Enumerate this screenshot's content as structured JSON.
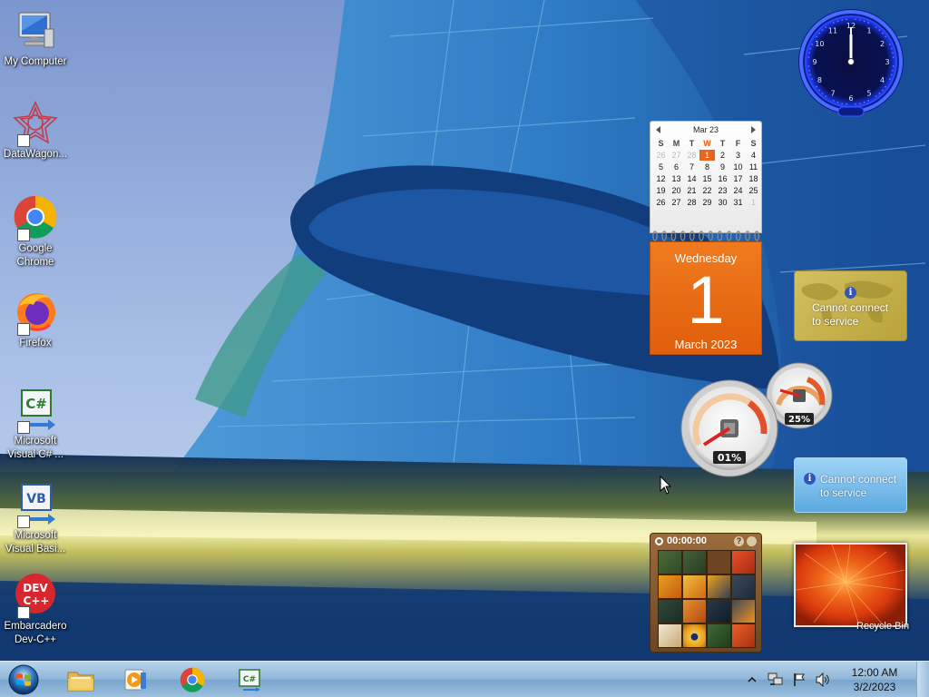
{
  "desktop_icons": [
    {
      "label": "My Computer",
      "icon": "computer-icon"
    },
    {
      "label": "DataWagon...",
      "icon": "datawagon-icon"
    },
    {
      "label": "Google\nChrome",
      "icon": "chrome-icon"
    },
    {
      "label": "Firefox",
      "icon": "firefox-icon"
    },
    {
      "label": "Microsoft\nVisual C# ...",
      "icon": "visual-csharp-icon"
    },
    {
      "label": "Microsoft\nVisual Basi...",
      "icon": "visual-basic-icon"
    },
    {
      "label": "Embarcadero\nDev-C++",
      "icon": "devcpp-icon"
    }
  ],
  "clock_gadget": {
    "time": "12:00",
    "numerals": [
      "12",
      "1",
      "2",
      "3",
      "4",
      "5",
      "6",
      "7",
      "8",
      "9",
      "10",
      "11"
    ]
  },
  "calendar": {
    "month_label": "Mar 23",
    "weekday_headers": [
      "S",
      "M",
      "T",
      "W",
      "T",
      "F",
      "S"
    ],
    "current_weekday_index": 3,
    "weeks": [
      [
        "26",
        "27",
        "28",
        "1",
        "2",
        "3",
        "4"
      ],
      [
        "5",
        "6",
        "7",
        "8",
        "9",
        "10",
        "11"
      ],
      [
        "12",
        "13",
        "14",
        "15",
        "16",
        "17",
        "18"
      ],
      [
        "19",
        "20",
        "21",
        "22",
        "23",
        "24",
        "25"
      ],
      [
        "26",
        "27",
        "28",
        "29",
        "30",
        "31",
        "1"
      ]
    ],
    "selected_day": "1",
    "day_of_week": "Wednesday",
    "day_number": "1",
    "month_year": "March 2023"
  },
  "weather_gadgets": [
    {
      "message_line1": "Cannot connect",
      "message_line2": "to service"
    },
    {
      "message_line1": "Cannot connect",
      "message_line2": "to service"
    }
  ],
  "cpu_meter": {
    "cpu_percent": "01%",
    "memory_percent": "25%"
  },
  "puzzle": {
    "timer": "00:00:00",
    "help_label": "?"
  },
  "recycle_bin": {
    "label": "Recycle Bin"
  },
  "taskbar": {
    "apps": [
      "file-explorer-icon",
      "media-player-icon",
      "chrome-icon",
      "visual-csharp-icon"
    ],
    "clock_time": "12:00 AM",
    "clock_date": "3/2/2023"
  },
  "colors": {
    "calendar_orange": "#e8661a",
    "clock_glow": "#1e3cff",
    "taskbar": "#9cc0de"
  }
}
